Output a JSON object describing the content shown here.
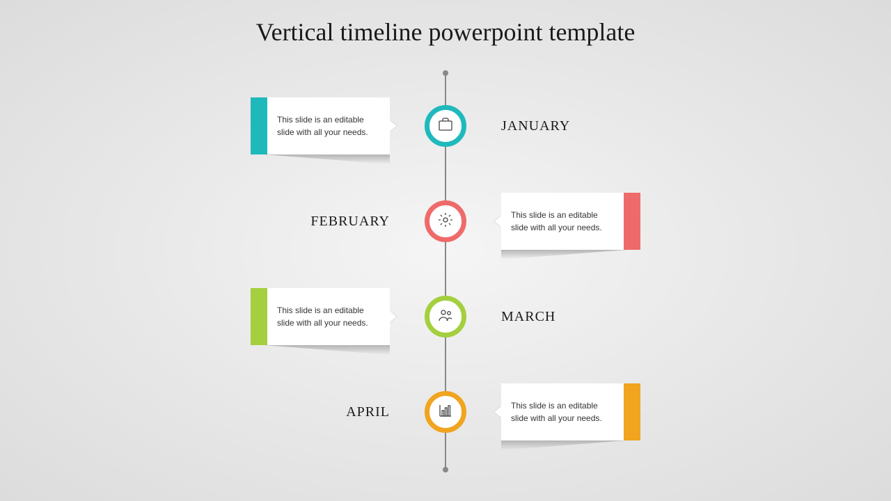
{
  "title": "Vertical timeline powerpoint template",
  "items": [
    {
      "month": "JANUARY",
      "color": "#1fb9bc",
      "desc": "This slide is an editable slide with all your needs.",
      "side": "left",
      "icon": "briefcase"
    },
    {
      "month": "FEBRUARY",
      "color": "#ef6a6a",
      "desc": "This slide is an editable slide with all your needs.",
      "side": "right",
      "icon": "gear"
    },
    {
      "month": "MARCH",
      "color": "#a4cf3e",
      "desc": "This slide is an editable slide with all your needs.",
      "side": "left",
      "icon": "people"
    },
    {
      "month": "APRIL",
      "color": "#f0a41f",
      "desc": "This slide is an editable slide with all your needs.",
      "side": "right",
      "icon": "chart"
    }
  ]
}
